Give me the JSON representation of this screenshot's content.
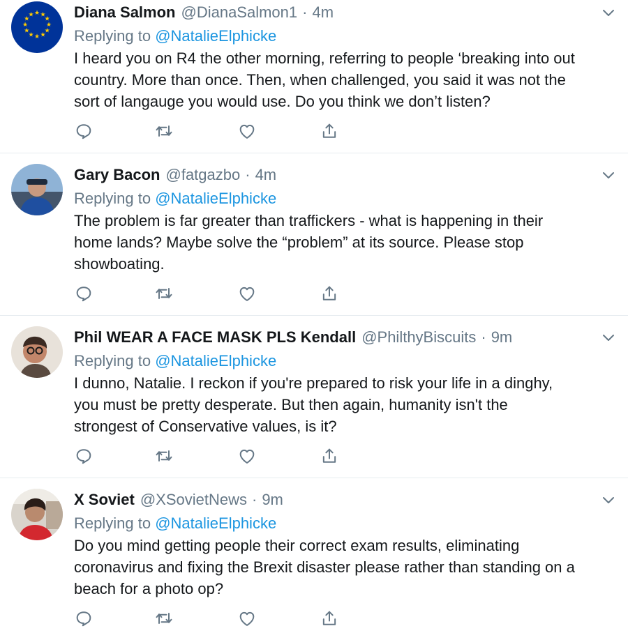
{
  "tweets": [
    {
      "name": "Diana Salmon",
      "handle": "@DianaSalmon1",
      "separator": "·",
      "time": "4m",
      "replying_prefix": "Replying to",
      "replying_handle": "@NatalieElphicke",
      "text": "I heard you on R4 the other morning, referring to people ‘breaking into out\ncountry. More than once. Then, when challenged, you said it was not the\nsort of langauge you would use. Do you think we don’t listen?",
      "avatar": "eu-flag-avatar"
    },
    {
      "name": "Gary Bacon",
      "handle": "@fatgazbo",
      "separator": "·",
      "time": "4m",
      "replying_prefix": "Replying to",
      "replying_handle": "@NatalieElphicke",
      "text": "The problem is far greater than traffickers - what is happening in their\nhome lands? Maybe solve the “problem” at its source. Please stop\nshowboating.",
      "avatar": "photo-avatar"
    },
    {
      "name": "Phil WEAR A FACE MASK PLS Kendall",
      "handle": "@PhilthyBiscuits",
      "separator": "·",
      "time": "9m",
      "replying_prefix": "Replying to",
      "replying_handle": "@NatalieElphicke",
      "text": "I dunno, Natalie. I reckon if you're prepared to risk your life in a dinghy,\nyou must be pretty desperate. But then again, humanity isn't the\nstrongest of Conservative values, is it?",
      "avatar": "photo-avatar"
    },
    {
      "name": "X Soviet",
      "handle": "@XSovietNews",
      "separator": "·",
      "time": "9m",
      "replying_prefix": "Replying to",
      "replying_handle": "@NatalieElphicke",
      "text": "Do you mind getting people their correct exam results, eliminating\ncoronavirus and fixing the Brexit disaster please rather than standing on a\nbeach for a photo op?",
      "avatar": "photo-avatar"
    }
  ],
  "icons": {
    "reply": "reply-icon",
    "retweet": "retweet-icon",
    "like": "like-icon",
    "share": "share-icon",
    "menu": "chevron-down-icon"
  },
  "colors": {
    "link": "#1b95e0",
    "secondary_text": "#657786",
    "icon": "#657786",
    "divider": "#e6ecf0",
    "eu_blue": "#003399",
    "eu_star": "#ffcc00"
  }
}
